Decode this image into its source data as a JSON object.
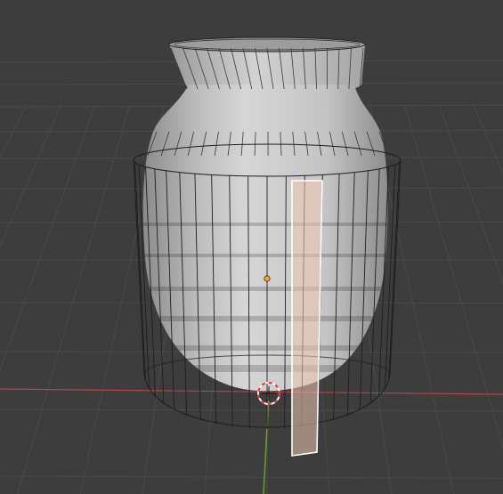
{
  "viewport": {
    "kind": "3d-viewport",
    "mode": "edit-mode",
    "selected_element": "face",
    "colors": {
      "background": "#3d3d3d",
      "grid": "#4a4a4a",
      "x_axis": "#b5434c",
      "y_axis": "#6c9a2c",
      "mesh_light": "#cfcfcf",
      "mesh_shadow": "#8e8e8e",
      "wire": "#1e1e1e",
      "selection_fill": "#f0c6b4",
      "selection_edge": "#ffffff",
      "origin": "#f5a23a",
      "cursor_red": "#e0332e"
    },
    "icons": {
      "origin": "object-origin-icon",
      "cursor": "3d-cursor-icon"
    }
  }
}
